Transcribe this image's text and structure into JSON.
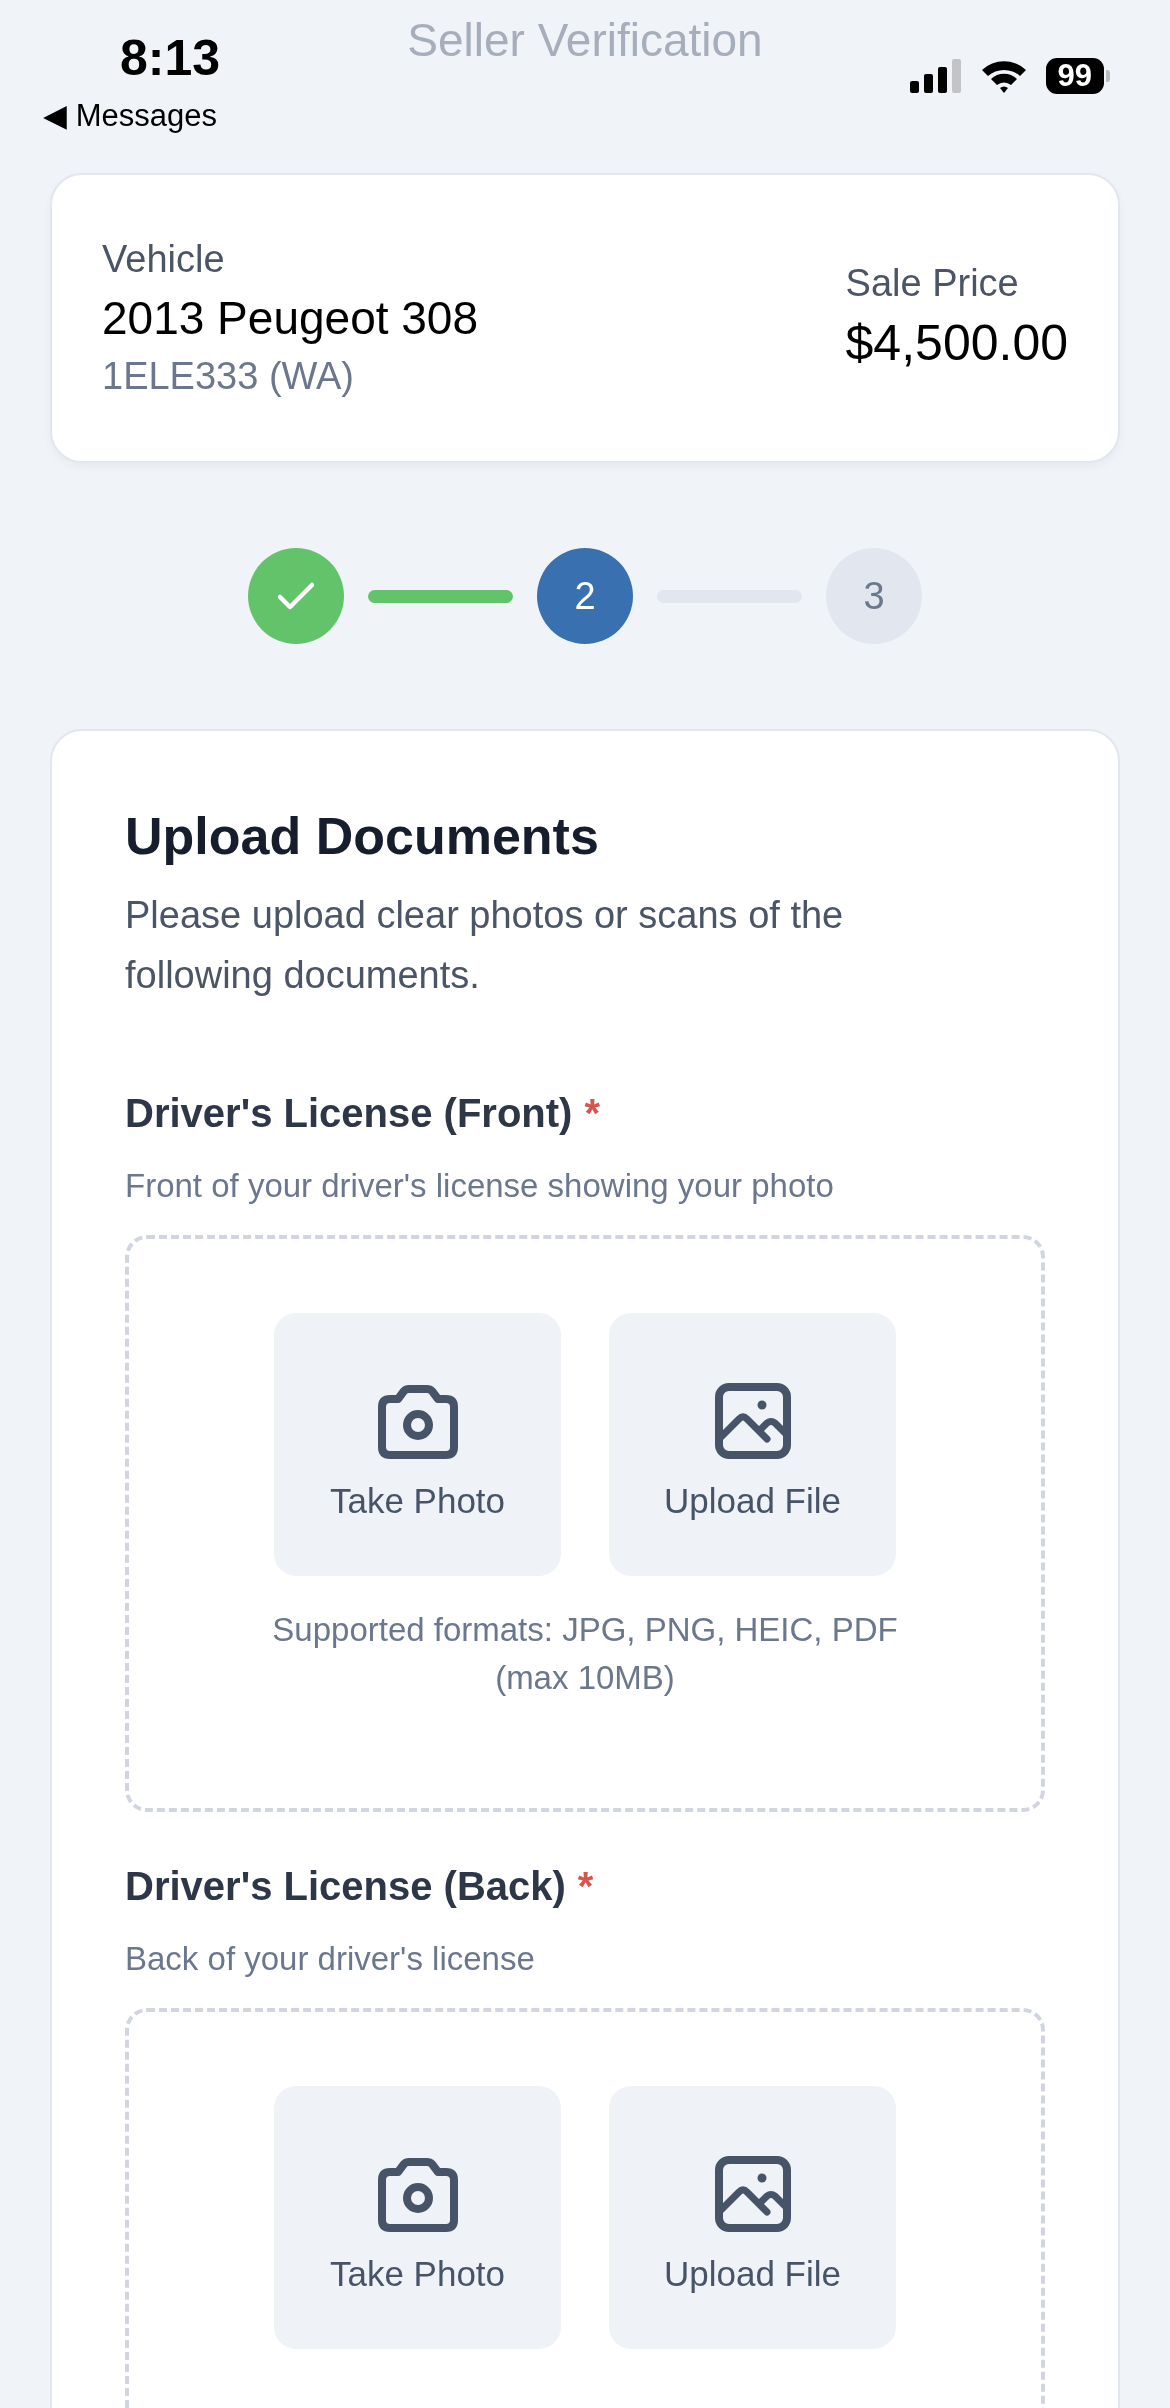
{
  "status_bar": {
    "time": "8:13",
    "back_label": "◀ Messages",
    "battery": "99"
  },
  "title": "Seller Verification",
  "vehicle": {
    "label": "Vehicle",
    "name": "2013 Peugeot 308",
    "plate": "1ELE333 (WA)",
    "price_label": "Sale Price",
    "price": "$4,500.00"
  },
  "steps": [
    {
      "completed": true,
      "selected": false
    },
    {
      "completed": false,
      "selected": true,
      "label": "2"
    },
    {
      "completed": false,
      "selected": false,
      "label": "3"
    }
  ],
  "upload": {
    "heading": "Upload Documents",
    "intro": "Please upload clear photos or scans of the following documents.",
    "documents": [
      {
        "label": "Driver's License (Front)",
        "required": true,
        "required_mark": "*",
        "description": "Front of your driver's license showing your photo",
        "actions": [
          {
            "kind": "camera",
            "label": "Take Photo"
          },
          {
            "kind": "file",
            "label": "Upload File"
          }
        ],
        "formats": [
          "Supported formats: JPG, PNG, HEIC, PDF",
          "(max 10MB)"
        ]
      },
      {
        "label": "Driver's License (Back)",
        "required": true,
        "required_mark": "*",
        "description": "Back of your driver's license",
        "actions": [
          {
            "kind": "camera",
            "label": "Take Photo"
          },
          {
            "kind": "file",
            "label": "Upload File"
          }
        ]
      }
    ]
  }
}
